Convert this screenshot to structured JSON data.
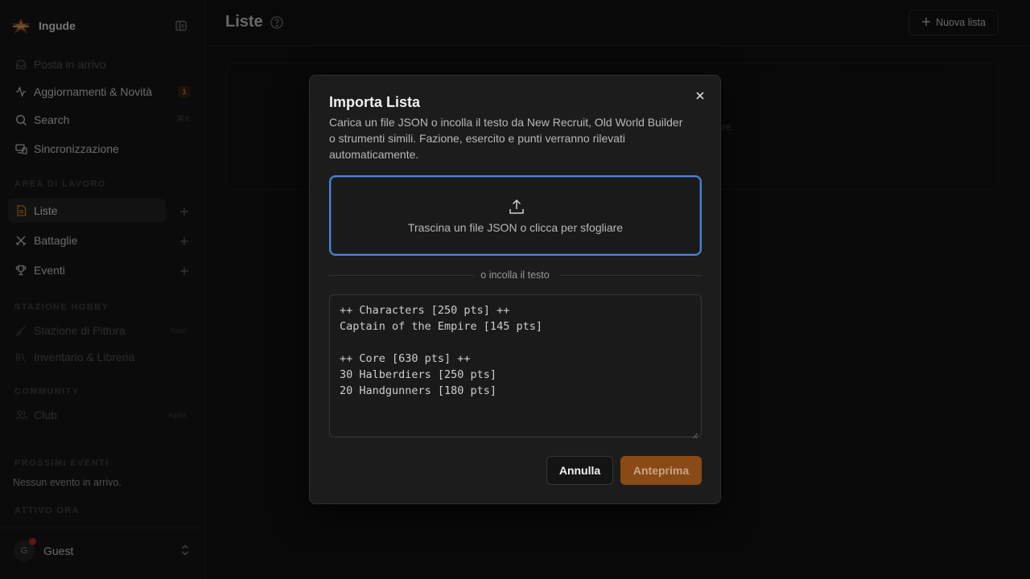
{
  "app": {
    "name": "Ingude"
  },
  "sidebar": {
    "items": [
      {
        "label": "Posta in arrivo",
        "icon": "inbox-icon"
      },
      {
        "label": "Aggiornamenti & Novità",
        "icon": "activity-icon",
        "badge": "1"
      },
      {
        "label": "Search",
        "icon": "search-icon",
        "shortcut": "⌘K"
      },
      {
        "label": "Sincronizzazione",
        "icon": "devices-icon"
      }
    ],
    "workspace": {
      "label": "AREA DI LAVORO",
      "items": [
        {
          "label": "Liste",
          "icon": "file-list-icon"
        },
        {
          "label": "Battaglie",
          "icon": "crossed-swords-icon"
        },
        {
          "label": "Eventi",
          "icon": "trophy-icon"
        }
      ]
    },
    "hobby": {
      "label": "STAZIONE HOBBY",
      "items": [
        {
          "label": "Stazione di Pittura",
          "icon": "brush-icon",
          "tag": "Soon"
        },
        {
          "label": "Inventario & Libreria",
          "icon": "library-icon"
        }
      ]
    },
    "community": {
      "label": "COMMUNITY",
      "items": [
        {
          "label": "Club",
          "icon": "users-icon",
          "tag": "Alpha"
        }
      ]
    },
    "upcoming": {
      "label": "PROSSIMI EVENTI",
      "text": "Nessun evento in arrivo."
    },
    "active": {
      "label": "ATTIVO ORA"
    },
    "user": {
      "initial": "G",
      "name": "Guest"
    }
  },
  "header": {
    "title": "Liste",
    "new_list_label": "Nuova lista"
  },
  "empty_state": {
    "text_fragment": "re."
  },
  "modal": {
    "title": "Importa Lista",
    "description": "Carica un file JSON o incolla il testo da New Recruit, Old World Builder o strumenti simili. Fazione, esercito e punti verranno rilevati automaticamente.",
    "dropzone_text": "Trascina un file JSON o clicca per sfogliare",
    "divider_text": "o incolla il testo",
    "paste_text": "++ Characters [250 pts] ++\nCaptain of the Empire [145 pts]\n\n++ Core [630 pts] ++\n30 Halberdiers [250 pts]\n20 Handgunners [180 pts]",
    "cancel_label": "Annulla",
    "preview_label": "Anteprima"
  },
  "colors": {
    "accent": "#d8822e",
    "focus": "#4b84d6",
    "preview_button": "#8a4a16"
  }
}
